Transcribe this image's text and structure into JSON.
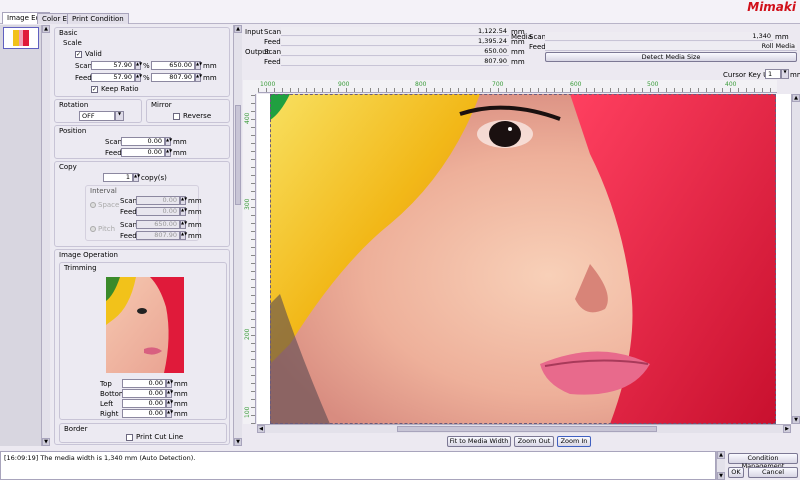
{
  "brand": "Mimaki",
  "tabs": [
    "Image Edit",
    "Color Edit",
    "Print Condition"
  ],
  "basic": {
    "title": "Basic",
    "scale_title": "Scale",
    "valid": "Valid",
    "scan_label": "Scan",
    "feed_label": "Feed",
    "scan_pct": "57.90",
    "feed_pct": "57.90",
    "pct_unit": "%",
    "scan_mm": "650.00",
    "feed_mm": "807.90",
    "mm": "mm",
    "keep_ratio": "Keep Ratio"
  },
  "rotation": {
    "title": "Rotation",
    "value": "OFF"
  },
  "mirror": {
    "title": "Mirror",
    "reverse": "Reverse"
  },
  "position": {
    "title": "Position",
    "scan_label": "Scan",
    "feed_label": "Feed",
    "scan": "0.00",
    "feed": "0.00",
    "mm": "mm"
  },
  "copy": {
    "title": "Copy",
    "count": "1",
    "unit": "copy(s)",
    "interval": "Interval",
    "space": "Space",
    "pitch": "Pitch",
    "scan_label": "Scan",
    "feed_label": "Feed",
    "space_scan": "0.00",
    "space_feed": "0.00",
    "pitch_scan": "650.00",
    "pitch_feed": "807.90",
    "mm": "mm"
  },
  "image_operation": {
    "title": "Image Operation",
    "trimming": "Trimming",
    "top_label": "Top",
    "bottom_label": "Bottom",
    "left_label": "Left",
    "right_label": "Right",
    "top": "0.00",
    "bottom": "0.00",
    "left": "0.00",
    "right": "0.00",
    "mm": "mm"
  },
  "border": {
    "title": "Border",
    "print_cut_line": "Print Cut Line"
  },
  "info": {
    "input": "Input",
    "output": "Output",
    "scan": "Scan",
    "feed": "Feed",
    "input_scan": "1,122.54",
    "input_feed": "1,395.24",
    "output_scan": "650.00",
    "output_feed": "807.90",
    "mm": "mm",
    "media": "Media",
    "media_scan": "1,340",
    "media_feed": "Roll Media",
    "detect_media_size": "Detect Media Size",
    "cursor_key_unit": "Cursor Key Unit",
    "cursor_value": "1"
  },
  "ruler_h": [
    "1000",
    "900",
    "800",
    "700",
    "600",
    "500",
    "400"
  ],
  "ruler_v": [
    "400",
    "300",
    "200",
    "100"
  ],
  "buttons": {
    "fit": "Fit to Media Width",
    "zoom_out": "Zoom Out",
    "zoom_in": "Zoom In",
    "condition_management": "Condition Management",
    "ok": "OK",
    "cancel": "Cancel"
  },
  "status_message": "[16:09:19] The media width is 1,340 mm (Auto Detection).",
  "colors": {
    "accent": "#d0101a",
    "ruler_text": "#3a9c3a",
    "red": "#e01a3a",
    "yellow": "#f2c21a"
  }
}
